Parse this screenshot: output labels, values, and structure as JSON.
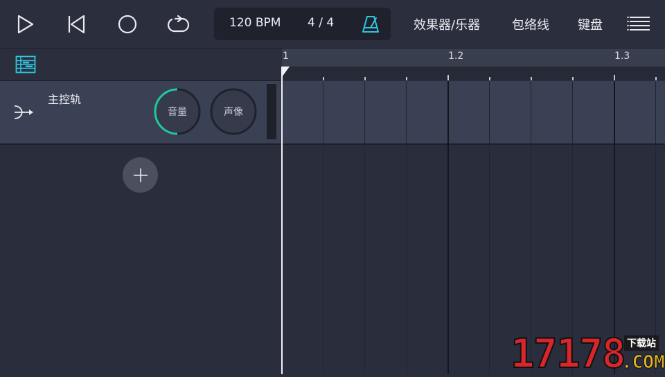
{
  "toolbar": {
    "bpm": "120 BPM",
    "time_signature": "4 / 4",
    "menu": [
      "效果器/乐器",
      "包络线",
      "键盘"
    ],
    "icons": [
      "play-icon",
      "skip-back-icon",
      "record-icon",
      "loop-icon",
      "metronome-icon",
      "menu-icon"
    ],
    "accent_color": "#2fc8e0"
  },
  "ruler": {
    "labels": [
      "1",
      "1.2",
      "1.3"
    ]
  },
  "tracks": [
    {
      "name": "主控轨",
      "volume_label": "音量",
      "pan_label": "声像",
      "volume_level": 0.5,
      "knob_color": "#22c9a0"
    }
  ],
  "watermark": {
    "number": "17178",
    "tag": "下载站",
    "domain": ".COM"
  }
}
